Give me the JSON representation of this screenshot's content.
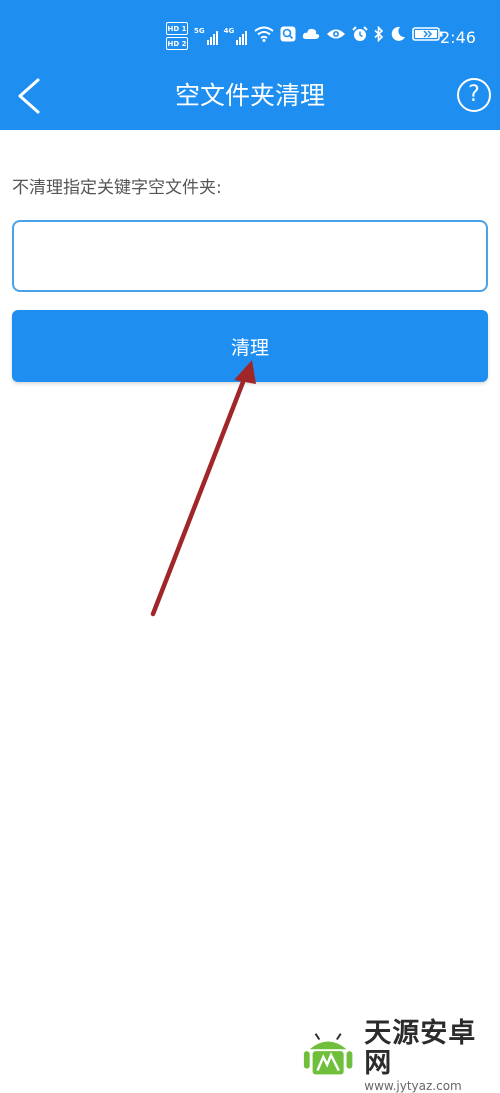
{
  "status_bar": {
    "hd1": "HD 1",
    "hd2": "HD 2",
    "net1": "5G",
    "net2": "4G",
    "time": "2:46"
  },
  "header": {
    "title": "空文件夹清理",
    "help_label": "?"
  },
  "form": {
    "label": "不清理指定关键字空文件夹:",
    "input_value": "",
    "input_placeholder": "",
    "clean_label": "清理"
  },
  "watermark": {
    "title": "天源安卓网",
    "url": "www.jytyaz.com"
  },
  "colors": {
    "accent": "#1e8ff0",
    "arrow": "#a0262a"
  }
}
